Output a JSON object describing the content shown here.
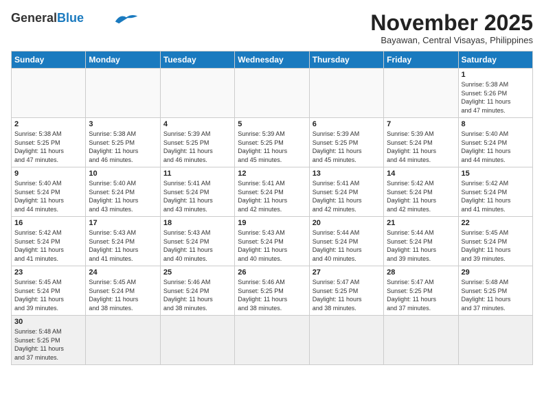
{
  "header": {
    "logo_general": "General",
    "logo_blue": "Blue",
    "title": "November 2025",
    "location": "Bayawan, Central Visayas, Philippines"
  },
  "days_of_week": [
    "Sunday",
    "Monday",
    "Tuesday",
    "Wednesday",
    "Thursday",
    "Friday",
    "Saturday"
  ],
  "weeks": [
    [
      {
        "day": "",
        "info": ""
      },
      {
        "day": "",
        "info": ""
      },
      {
        "day": "",
        "info": ""
      },
      {
        "day": "",
        "info": ""
      },
      {
        "day": "",
        "info": ""
      },
      {
        "day": "",
        "info": ""
      },
      {
        "day": "1",
        "info": "Sunrise: 5:38 AM\nSunset: 5:26 PM\nDaylight: 11 hours\nand 47 minutes."
      }
    ],
    [
      {
        "day": "2",
        "info": "Sunrise: 5:38 AM\nSunset: 5:25 PM\nDaylight: 11 hours\nand 47 minutes."
      },
      {
        "day": "3",
        "info": "Sunrise: 5:38 AM\nSunset: 5:25 PM\nDaylight: 11 hours\nand 46 minutes."
      },
      {
        "day": "4",
        "info": "Sunrise: 5:39 AM\nSunset: 5:25 PM\nDaylight: 11 hours\nand 46 minutes."
      },
      {
        "day": "5",
        "info": "Sunrise: 5:39 AM\nSunset: 5:25 PM\nDaylight: 11 hours\nand 45 minutes."
      },
      {
        "day": "6",
        "info": "Sunrise: 5:39 AM\nSunset: 5:25 PM\nDaylight: 11 hours\nand 45 minutes."
      },
      {
        "day": "7",
        "info": "Sunrise: 5:39 AM\nSunset: 5:24 PM\nDaylight: 11 hours\nand 44 minutes."
      },
      {
        "day": "8",
        "info": "Sunrise: 5:40 AM\nSunset: 5:24 PM\nDaylight: 11 hours\nand 44 minutes."
      }
    ],
    [
      {
        "day": "9",
        "info": "Sunrise: 5:40 AM\nSunset: 5:24 PM\nDaylight: 11 hours\nand 44 minutes."
      },
      {
        "day": "10",
        "info": "Sunrise: 5:40 AM\nSunset: 5:24 PM\nDaylight: 11 hours\nand 43 minutes."
      },
      {
        "day": "11",
        "info": "Sunrise: 5:41 AM\nSunset: 5:24 PM\nDaylight: 11 hours\nand 43 minutes."
      },
      {
        "day": "12",
        "info": "Sunrise: 5:41 AM\nSunset: 5:24 PM\nDaylight: 11 hours\nand 42 minutes."
      },
      {
        "day": "13",
        "info": "Sunrise: 5:41 AM\nSunset: 5:24 PM\nDaylight: 11 hours\nand 42 minutes."
      },
      {
        "day": "14",
        "info": "Sunrise: 5:42 AM\nSunset: 5:24 PM\nDaylight: 11 hours\nand 42 minutes."
      },
      {
        "day": "15",
        "info": "Sunrise: 5:42 AM\nSunset: 5:24 PM\nDaylight: 11 hours\nand 41 minutes."
      }
    ],
    [
      {
        "day": "16",
        "info": "Sunrise: 5:42 AM\nSunset: 5:24 PM\nDaylight: 11 hours\nand 41 minutes."
      },
      {
        "day": "17",
        "info": "Sunrise: 5:43 AM\nSunset: 5:24 PM\nDaylight: 11 hours\nand 41 minutes."
      },
      {
        "day": "18",
        "info": "Sunrise: 5:43 AM\nSunset: 5:24 PM\nDaylight: 11 hours\nand 40 minutes."
      },
      {
        "day": "19",
        "info": "Sunrise: 5:43 AM\nSunset: 5:24 PM\nDaylight: 11 hours\nand 40 minutes."
      },
      {
        "day": "20",
        "info": "Sunrise: 5:44 AM\nSunset: 5:24 PM\nDaylight: 11 hours\nand 40 minutes."
      },
      {
        "day": "21",
        "info": "Sunrise: 5:44 AM\nSunset: 5:24 PM\nDaylight: 11 hours\nand 39 minutes."
      },
      {
        "day": "22",
        "info": "Sunrise: 5:45 AM\nSunset: 5:24 PM\nDaylight: 11 hours\nand 39 minutes."
      }
    ],
    [
      {
        "day": "23",
        "info": "Sunrise: 5:45 AM\nSunset: 5:24 PM\nDaylight: 11 hours\nand 39 minutes."
      },
      {
        "day": "24",
        "info": "Sunrise: 5:45 AM\nSunset: 5:24 PM\nDaylight: 11 hours\nand 38 minutes."
      },
      {
        "day": "25",
        "info": "Sunrise: 5:46 AM\nSunset: 5:24 PM\nDaylight: 11 hours\nand 38 minutes."
      },
      {
        "day": "26",
        "info": "Sunrise: 5:46 AM\nSunset: 5:25 PM\nDaylight: 11 hours\nand 38 minutes."
      },
      {
        "day": "27",
        "info": "Sunrise: 5:47 AM\nSunset: 5:25 PM\nDaylight: 11 hours\nand 38 minutes."
      },
      {
        "day": "28",
        "info": "Sunrise: 5:47 AM\nSunset: 5:25 PM\nDaylight: 11 hours\nand 37 minutes."
      },
      {
        "day": "29",
        "info": "Sunrise: 5:48 AM\nSunset: 5:25 PM\nDaylight: 11 hours\nand 37 minutes."
      }
    ],
    [
      {
        "day": "30",
        "info": "Sunrise: 5:48 AM\nSunset: 5:25 PM\nDaylight: 11 hours\nand 37 minutes."
      },
      {
        "day": "",
        "info": ""
      },
      {
        "day": "",
        "info": ""
      },
      {
        "day": "",
        "info": ""
      },
      {
        "day": "",
        "info": ""
      },
      {
        "day": "",
        "info": ""
      },
      {
        "day": "",
        "info": ""
      }
    ]
  ]
}
